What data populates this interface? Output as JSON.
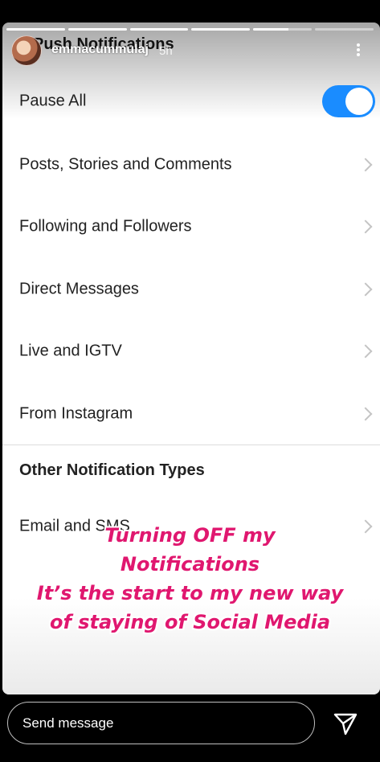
{
  "story": {
    "progress_segments": [
      1,
      1,
      1,
      1,
      0.6,
      0
    ],
    "username": "emmacummulaj",
    "time_ago": "5h"
  },
  "settings": {
    "page_title": "Push Notifications",
    "pause_all": {
      "label": "Pause All",
      "enabled": true
    },
    "items": [
      {
        "label": "Posts, Stories and Comments"
      },
      {
        "label": "Following and Followers"
      },
      {
        "label": "Direct Messages"
      },
      {
        "label": "Live and IGTV"
      },
      {
        "label": "From Instagram"
      }
    ],
    "section_title": "Other Notification Types",
    "other_items": [
      {
        "label": "Email and SMS"
      }
    ]
  },
  "overlay_text": {
    "line1": "Turning OFF my",
    "line2": "Notifications",
    "line3": "It’s the start to my new way",
    "line4": "of staying of Social Media"
  },
  "footer": {
    "message_placeholder": "Send message"
  },
  "colors": {
    "toggle_on": "#1a8cff",
    "overlay_text": "#e0176f"
  }
}
